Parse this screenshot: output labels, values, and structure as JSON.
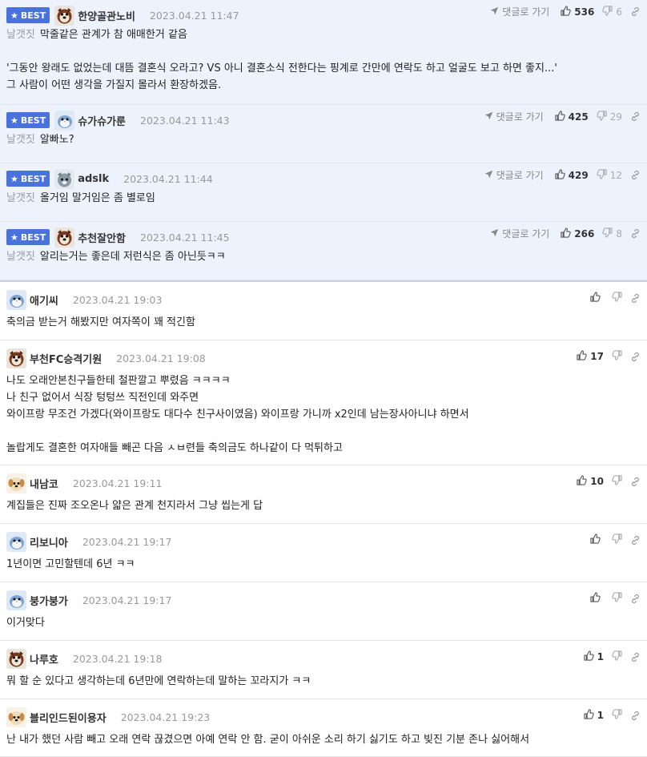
{
  "best_badge": "BEST",
  "reply_link_label": "댓글로 가기",
  "best_comments": [
    {
      "nick": "한양골관노비",
      "date": "2023.04.21 11:47",
      "up": "536",
      "down": "6",
      "prefix": "날갯짓",
      "text": "막줄같은 관계가 참 애매한거 같음\n\n'그동안 왕래도 없었는데 대뜸 결혼식 오라고? VS 아니 결혼소식 전한다는 핑계로 간만에 연락도 하고 얼굴도 보고 하면 좋지...'\n그 사람이 어떤 생각을 가질지 몰라서 환장하겠음.",
      "avatar": "dog-face"
    },
    {
      "nick": "슈가슈가룬",
      "date": "2023.04.21 11:43",
      "up": "425",
      "down": "29",
      "prefix": "날갯짓",
      "text": "알빠노?",
      "avatar": "bird"
    },
    {
      "nick": "adslk",
      "date": "2023.04.21 11:44",
      "up": "429",
      "down": "12",
      "prefix": "날갯짓",
      "text": "올거임 말거임은 좀 별로임",
      "avatar": "cat-gray"
    },
    {
      "nick": "추천잘안함",
      "date": "2023.04.21 11:45",
      "up": "266",
      "down": "8",
      "prefix": "날갯짓",
      "text": "알리는거는 좋은데 저런식은 좀 아닌듯ㅋㅋ",
      "avatar": "dog-face"
    }
  ],
  "comments": [
    {
      "nick": "애기씨",
      "date": "2023.04.21 19:03",
      "up": "",
      "text": "축의금 받는거 해봤지만 여자쪽이 꽤 적긴함",
      "avatar": "bird"
    },
    {
      "nick": "부천FC승격기원",
      "date": "2023.04.21 19:08",
      "up": "17",
      "text": "나도 오래안본친구들한테 철판깔고 뿌렸음 ㅋㅋㅋㅋ\n나 친구 없어서 식장 텅텅쓰 직전인데 와주면\n와이프랑 무조건 가겠다(와이프랑도 대다수 친구사이였음) 와이프랑 가니까 x2인데 남는장사아니냐 하면서\n\n놀랍게도 결혼한 여자애들 빼곤 다음 ㅅㅂ련들 축의금도 하나같이 다 먹튀하고",
      "avatar": "dog-face"
    },
    {
      "nick": "내남코",
      "date": "2023.04.21 19:11",
      "up": "10",
      "text": "계집들은 진짜 조오온나 얇은 관계 천지라서 그냥 씹는게 답",
      "avatar": "puppy"
    },
    {
      "nick": "리보니아",
      "date": "2023.04.21 19:17",
      "up": "",
      "text": "1년이면 고민할텐데 6년 ㅋㅋ",
      "avatar": "bird"
    },
    {
      "nick": "붕가붕가",
      "date": "2023.04.21 19:17",
      "up": "",
      "text": "이거맞다",
      "avatar": "bird"
    },
    {
      "nick": "나루호",
      "date": "2023.04.21 19:18",
      "up": "1",
      "text": "뭐 할 순 있다고 생각하는데 6년만에 연락하는데 말하는 꼬라지가 ㅋㅋ",
      "avatar": "dog-face"
    },
    {
      "nick": "블리인드된이용자",
      "date": "2023.04.21 19:23",
      "up": "1",
      "text": "난 내가 했던 사람 빼고 오래 연락 끊겼으면 아예 연락 안 함. 굳이 아쉬운 소리 하기 싫기도 하고 빚진 기분 존나 싫어해서",
      "avatar": "puppy"
    }
  ]
}
